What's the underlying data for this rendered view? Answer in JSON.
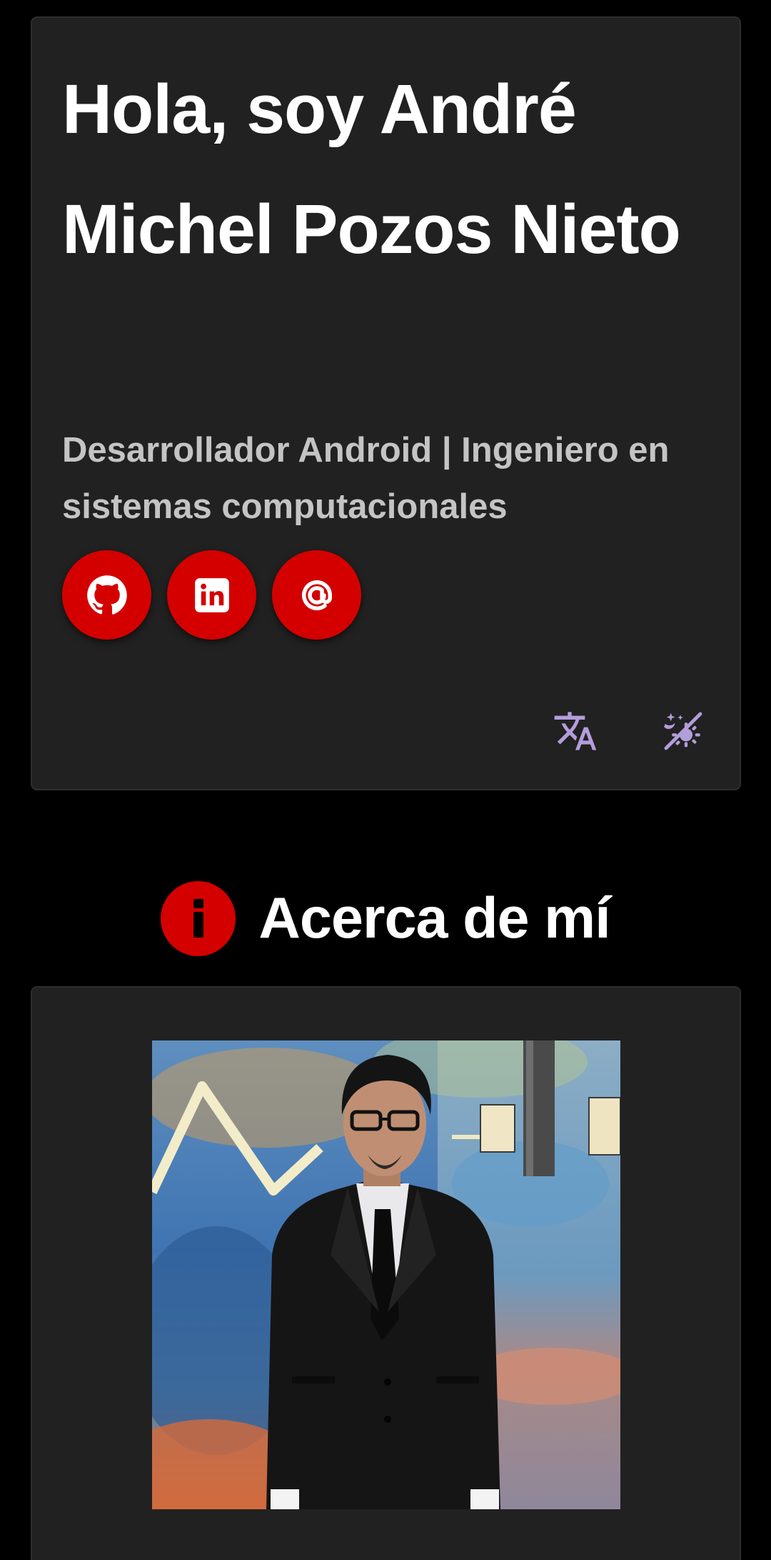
{
  "hero": {
    "title": "Hola, soy André Michel Pozos Nieto",
    "subtitle": "Desarrollador Android | Ingeniero en sistemas computacionales",
    "social_links": [
      {
        "name": "GitHub",
        "icon": "github-icon"
      },
      {
        "name": "LinkedIn",
        "icon": "linkedin-icon"
      },
      {
        "name": "Email",
        "icon": "at-sign-icon"
      }
    ],
    "tools": [
      {
        "name": "Translate",
        "icon": "translate-icon"
      },
      {
        "name": "Theme",
        "icon": "theme-toggle-icon"
      }
    ]
  },
  "about": {
    "title": "Acerca de mí",
    "header_icon": "info-icon",
    "photo": {
      "subject": "profile-photo"
    }
  },
  "colors": {
    "background": "#000000",
    "card": "#212121",
    "accent_red": "#d40000",
    "icon_purple": "#b39ddb",
    "subtitle_gray": "#c4c4c4"
  }
}
